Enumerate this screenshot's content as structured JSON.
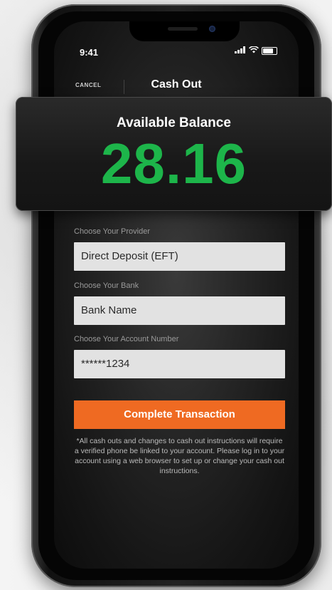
{
  "status_bar": {
    "time": "9:41"
  },
  "nav": {
    "cancel_label": "CANCEL",
    "title": "Cash Out"
  },
  "balance": {
    "label": "Available Balance",
    "value": "28.16",
    "value_color": "#1db54a"
  },
  "form": {
    "provider": {
      "label": "Choose Your Provider",
      "value": "Direct Deposit (EFT)"
    },
    "bank": {
      "label": "Choose Your Bank",
      "value": "Bank Name"
    },
    "account": {
      "label": "Choose Your Account Number",
      "value": "******1234"
    }
  },
  "cta": {
    "label": "Complete Transaction",
    "color": "#ef6a22"
  },
  "disclaimer": "*All cash outs and changes to cash out instructions will require a verified phone be linked to your account. Please log in to your account using a web browser to set up or change your cash out instructions."
}
